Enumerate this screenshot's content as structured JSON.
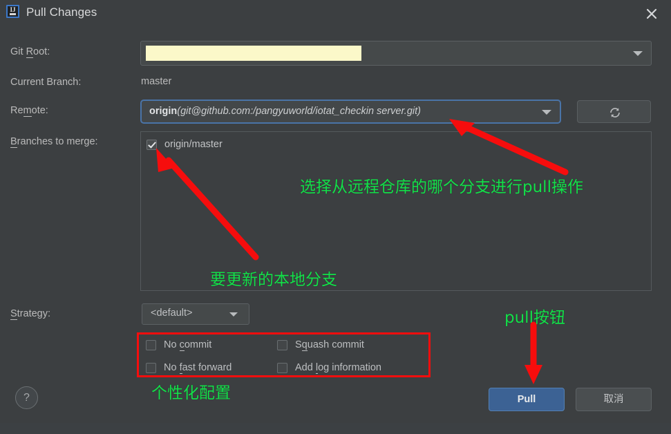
{
  "window": {
    "title": "Pull Changes",
    "app_icon": "intellij-idea-icon",
    "close_icon": "close-icon"
  },
  "form": {
    "git_root": {
      "label_pre": "Git ",
      "label_mnemonic": "R",
      "label_post": "oot:",
      "value": "",
      "redacted": true,
      "dropdown_icon": "chevron-down-icon"
    },
    "current_branch": {
      "label": "Current Branch:",
      "value": "master"
    },
    "remote": {
      "label_pre": "Re",
      "label_mnemonic": "m",
      "label_post": "ote:",
      "value_name": "origin",
      "value_url": "(git@github.com:/pangyuworld/iotat_checkin server.git)",
      "dropdown_icon": "chevron-down-icon",
      "refresh_icon": "refresh-icon",
      "focused": true
    },
    "branches_to_merge": {
      "label_pre": "",
      "label_mnemonic": "B",
      "label_post": "ranches to merge:",
      "items": [
        {
          "label": "origin/master",
          "checked": true
        }
      ]
    },
    "strategy": {
      "label_pre": "",
      "label_mnemonic": "S",
      "label_post": "trategy:",
      "value": "<default>",
      "dropdown_icon": "chevron-down-icon"
    },
    "options": [
      {
        "id": "no-commit",
        "pre": "No ",
        "mnemonic": "c",
        "post": "ommit",
        "checked": false
      },
      {
        "id": "squash-commit",
        "pre": "S",
        "mnemonic": "q",
        "post": "uash commit",
        "checked": false
      },
      {
        "id": "no-fast-fwd",
        "pre": "No ",
        "mnemonic": "f",
        "post": "ast forward",
        "checked": false
      },
      {
        "id": "add-log-info",
        "pre": "Add ",
        "mnemonic": "l",
        "post": "og information",
        "checked": false
      }
    ]
  },
  "buttons": {
    "help": "?",
    "pull": "Pull",
    "cancel": "取消"
  },
  "annotations": {
    "remote_branch": "选择从远程仓库的哪个分支进行pull操作",
    "local_branch": "要更新的本地分支",
    "options": "个性化配置",
    "pull_button": "pull按钮"
  },
  "colors": {
    "dialog_bg": "#3c3f41",
    "accent_blue": "#3c6294",
    "focus_border": "#4a74a8",
    "annotation_green": "#14e04a",
    "highlight_red": "#f60d0d",
    "redaction_yellow": "#fbf8c9"
  }
}
